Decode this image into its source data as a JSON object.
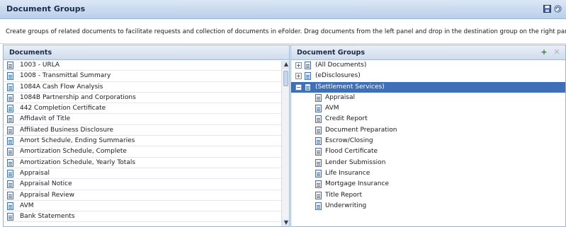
{
  "window": {
    "title": "Document Groups",
    "icons": [
      "save-icon",
      "refresh-icon"
    ]
  },
  "description": "Create groups of related documents to facilitate requests and collection of documents in eFolder. Drag documents from the left panel and drop in the destination group on the right panel.",
  "left_panel": {
    "header": "Documents",
    "items": [
      "1003 - URLA",
      "1008 - Transmittal Summary",
      "1084A Cash Flow Analysis",
      "1084B Partnership and Corporations",
      "442 Completion Certificate",
      "Affidavit of Title",
      "Affiliated Business Disclosure",
      "Amort Schedule, Ending Summaries",
      "Amortization Schedule, Complete",
      "Amortization Schedule, Yearly Totals",
      "Appraisal",
      "Appraisal Notice",
      "Appraisal Review",
      "AVM",
      "Bank Statements"
    ],
    "scroll_up": "▲",
    "scroll_down": "▼"
  },
  "right_panel": {
    "header": "Document Groups",
    "add_icon": "add-group-icon",
    "delete_icon": "delete-group-icon",
    "groups": [
      {
        "label": "(All Documents)",
        "toggle": "+",
        "expanded": false
      },
      {
        "label": "(eDisclosures)",
        "toggle": "+",
        "expanded": false
      },
      {
        "label": "(Settlement Services)",
        "toggle": "−",
        "expanded": true,
        "selected": true
      }
    ],
    "children": [
      "Appraisal",
      "AVM",
      "Credit Report",
      "Document Preparation",
      "Escrow/Closing",
      "Flood Certificate",
      "Lender Submission",
      "Life Insurance",
      "Mortgage Insurance",
      "Title Report",
      "Underwriting"
    ]
  },
  "colors": {
    "selected_row": "#3e6fb8",
    "header_gradient_top": "#dbe7f6",
    "header_gradient_bottom": "#b9cfe9"
  }
}
